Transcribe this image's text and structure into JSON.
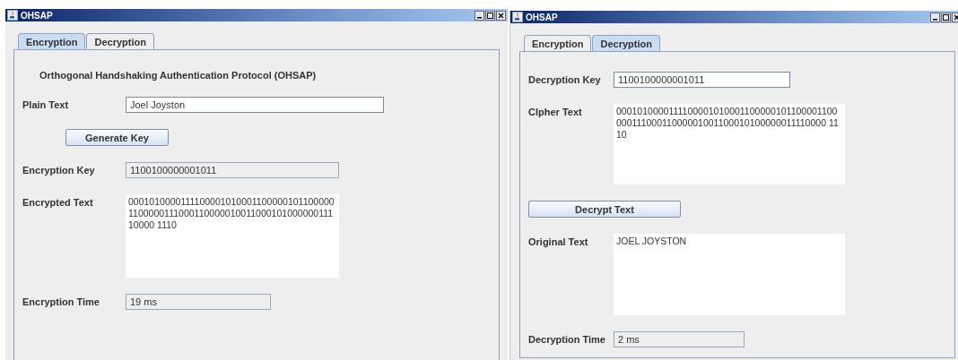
{
  "windows": [
    {
      "title": "OHSAP",
      "tabs": [
        {
          "label": "Encryption",
          "selected": true
        },
        {
          "label": "Decryption",
          "selected": false
        }
      ],
      "rows": [
        {
          "kind": "heading",
          "text": "Orthogonal Handshaking Authentication Protocol (OHSAP)"
        },
        {
          "kind": "field",
          "label": "Plain Text",
          "value": "Joel Joyston",
          "editable": true
        },
        {
          "kind": "button",
          "text": "Generate Key"
        },
        {
          "kind": "field",
          "label": "Encryption Key",
          "value": "1100100000001011",
          "editable": false
        },
        {
          "kind": "area",
          "label": "Encrypted Text",
          "value": "0001010000111100001010001100000101100000110000011100011000001001100010100000011110000 1110"
        },
        {
          "kind": "field",
          "label": "Encryption Time",
          "value": "19 ms",
          "editable": false
        }
      ]
    },
    {
      "title": "OHSAP",
      "tabs": [
        {
          "label": "Encryption",
          "selected": false
        },
        {
          "label": "Decryption",
          "selected": true
        }
      ],
      "rows": [
        {
          "kind": "field",
          "label": "Decryption Key",
          "value": "1100100000001011",
          "editable": true
        },
        {
          "kind": "area",
          "label": "Clpher Text",
          "value": "000101000011110000101000110000010110000110000011100011000001001100010100000011110000 1110"
        },
        {
          "kind": "button",
          "text": "Decrypt Text"
        },
        {
          "kind": "area",
          "label": "Original Text",
          "value": "JOEL JOYSTON"
        },
        {
          "kind": "field",
          "label": "Decryption Time",
          "value": "2 ms",
          "editable": false
        }
      ]
    }
  ]
}
